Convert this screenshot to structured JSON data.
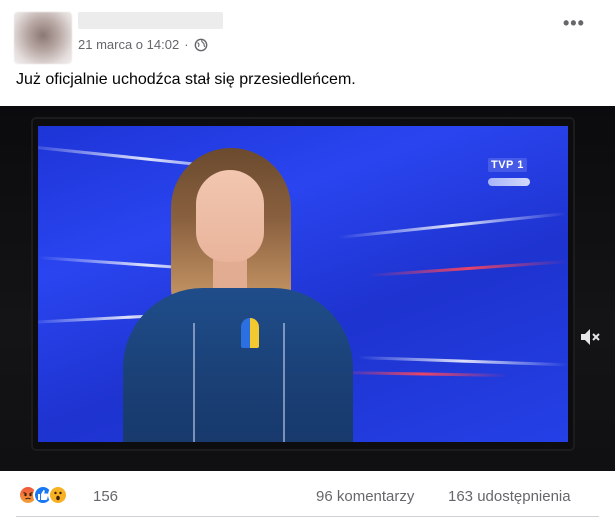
{
  "post": {
    "timestamp": "21 marca o 14:02",
    "separator": "·",
    "audience_icon": "globe-icon",
    "more_label": "•••",
    "text": "Już oficjalnie uchodźca stał się przesiedleńcem."
  },
  "media": {
    "channel_logo": "TVP 1",
    "mute_icon": "speaker-muted-icon"
  },
  "footer": {
    "reactions": [
      "angry-reaction-icon",
      "like-reaction-icon",
      "wow-reaction-icon"
    ],
    "reaction_count": "156",
    "comments": "96 komentarzy",
    "shares": "163 udostępnienia"
  },
  "colors": {
    "secondary_text": "#65676b",
    "primary_text": "#050505",
    "like_blue": "#1877f2",
    "tv_blue": "#2a45f0"
  }
}
